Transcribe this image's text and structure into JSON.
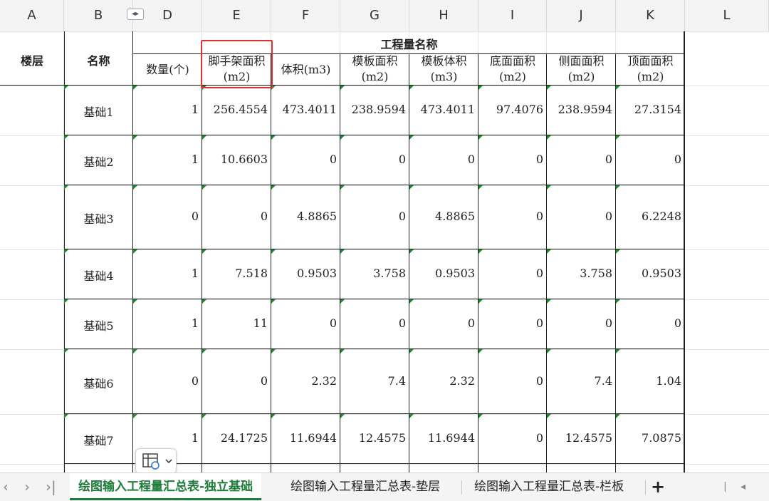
{
  "columns": [
    "A",
    "B",
    "D",
    "E",
    "F",
    "G",
    "H",
    "I",
    "J",
    "K",
    "L"
  ],
  "hidden_marker": "◂▸",
  "header": {
    "floor": "楼层",
    "name": "名称",
    "group": "工程量名称",
    "fields": [
      "数量(个)",
      "脚手架面积\n(m2)",
      "体积(m3)",
      "模板面积\n(m2)",
      "模板体积\n(m3)",
      "底面面积\n(m2)",
      "侧面面积\n(m2)",
      "顶面面积\n(m2)"
    ]
  },
  "rows": [
    {
      "name": "基础1",
      "values": [
        "1",
        "256.4554",
        "473.4011",
        "238.9594",
        "473.4011",
        "97.4076",
        "238.9594",
        "27.3154"
      ]
    },
    {
      "name": "基础2",
      "values": [
        "1",
        "10.6603",
        "0",
        "0",
        "0",
        "0",
        "0",
        "0"
      ]
    },
    {
      "name": "基础3",
      "values": [
        "0",
        "0",
        "4.8865",
        "0",
        "4.8865",
        "0",
        "0",
        "6.2248"
      ]
    },
    {
      "name": "基础4",
      "values": [
        "1",
        "7.518",
        "0.9503",
        "3.758",
        "0.9503",
        "0",
        "3.758",
        "0.9503"
      ]
    },
    {
      "name": "基础5",
      "values": [
        "1",
        "11",
        "0",
        "0",
        "0",
        "0",
        "0",
        "0"
      ]
    },
    {
      "name": "基础6",
      "values": [
        "0",
        "0",
        "2.32",
        "7.4",
        "2.32",
        "0",
        "7.4",
        "1.04"
      ]
    },
    {
      "name": "基础7",
      "values": [
        "1",
        "24.1725",
        "11.6944",
        "12.4575",
        "11.6944",
        "0",
        "12.4575",
        "7.0875"
      ]
    }
  ],
  "tabs": [
    "绘图输入工程量汇总表-独立基础",
    "绘图输入工程量汇总表-垫层",
    "绘图输入工程量汇总表-栏板"
  ],
  "active_tab": 0,
  "add_tab": "+",
  "accent": "#1e7d3a",
  "highlight": "#e03030"
}
